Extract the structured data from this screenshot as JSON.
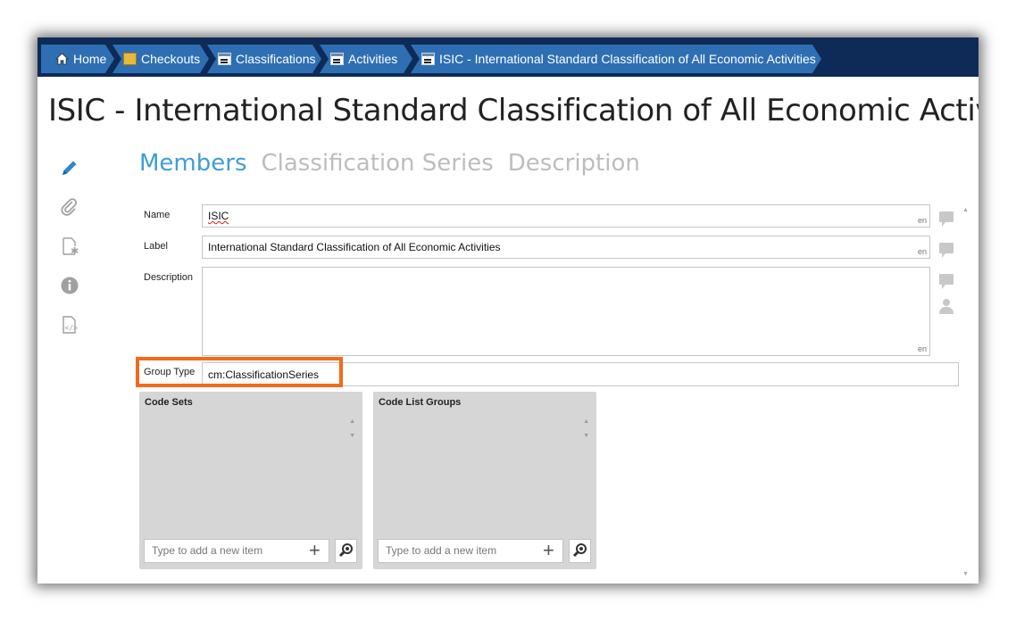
{
  "breadcrumb": [
    {
      "label": "Home",
      "icon": "home-icon"
    },
    {
      "label": "Checkouts",
      "icon": "folder-icon"
    },
    {
      "label": "Classifications",
      "icon": "document-icon"
    },
    {
      "label": "Activities",
      "icon": "document-icon"
    },
    {
      "label": "ISIC - International Standard Classification of All Economic Activities",
      "icon": "document-icon"
    }
  ],
  "page": {
    "title": "ISIC - International Standard Classification of All Economic Activities"
  },
  "tabs": [
    {
      "label": "Members",
      "active": true
    },
    {
      "label": "Classification Series",
      "active": false
    },
    {
      "label": "Description",
      "active": false
    }
  ],
  "form": {
    "name": {
      "label": "Name",
      "value": "ISIC",
      "lang": "en"
    },
    "label": {
      "label": "Label",
      "value": "International Standard Classification of All Economic Activities",
      "lang": "en"
    },
    "description": {
      "label": "Description",
      "value": "",
      "lang": "en"
    },
    "group_type": {
      "label": "Group Type",
      "value": "cm:ClassificationSeries"
    }
  },
  "panels": {
    "code_sets": {
      "title": "Code Sets",
      "placeholder": "Type to add a new item"
    },
    "code_list_groups": {
      "title": "Code List Groups",
      "placeholder": "Type to add a new item"
    }
  },
  "colors": {
    "topbar": "#0e2a57",
    "crumb": "#2e6fb3",
    "active_tab": "#3e9ed8",
    "highlight": "#f26b1d"
  }
}
